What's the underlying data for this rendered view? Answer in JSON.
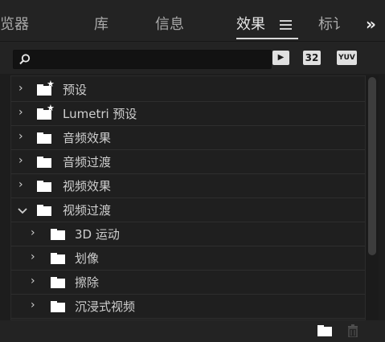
{
  "tabs": [
    {
      "label": "览器",
      "active": false
    },
    {
      "label": "库",
      "active": false
    },
    {
      "label": "信息",
      "active": false
    },
    {
      "label": "效果",
      "active": true
    },
    {
      "label": "标讠",
      "active": false
    }
  ],
  "icons": {
    "tab_menu": "hamburger-icon",
    "overflow": "double-chevron-right-icon",
    "search": "search-icon",
    "new_bin": "folder-icon",
    "delete": "trash-icon"
  },
  "search": {
    "value": "",
    "placeholder": ""
  },
  "filters": [
    {
      "name": "accelerated-effects",
      "label": "▶"
    },
    {
      "name": "32-bit-color",
      "label": "32"
    },
    {
      "name": "yuv",
      "label": "YUV"
    }
  ],
  "tree": [
    {
      "label": "预设",
      "expanded": false,
      "level": 0,
      "starred": true
    },
    {
      "label": "Lumetri 预设",
      "expanded": false,
      "level": 0,
      "starred": true
    },
    {
      "label": "音频效果",
      "expanded": false,
      "level": 0,
      "starred": false
    },
    {
      "label": "音频过渡",
      "expanded": false,
      "level": 0,
      "starred": false
    },
    {
      "label": "视频效果",
      "expanded": false,
      "level": 0,
      "starred": false
    },
    {
      "label": "视频过渡",
      "expanded": true,
      "level": 0,
      "starred": false
    },
    {
      "label": "3D 运动",
      "expanded": false,
      "level": 1,
      "starred": false
    },
    {
      "label": "划像",
      "expanded": false,
      "level": 1,
      "starred": false
    },
    {
      "label": "擦除",
      "expanded": false,
      "level": 1,
      "starred": false
    },
    {
      "label": "沉浸式视频",
      "expanded": false,
      "level": 1,
      "starred": false
    }
  ],
  "colors": {
    "accent": "#d9d9d9",
    "panel": "#1f1f1f",
    "background": "#232323"
  }
}
